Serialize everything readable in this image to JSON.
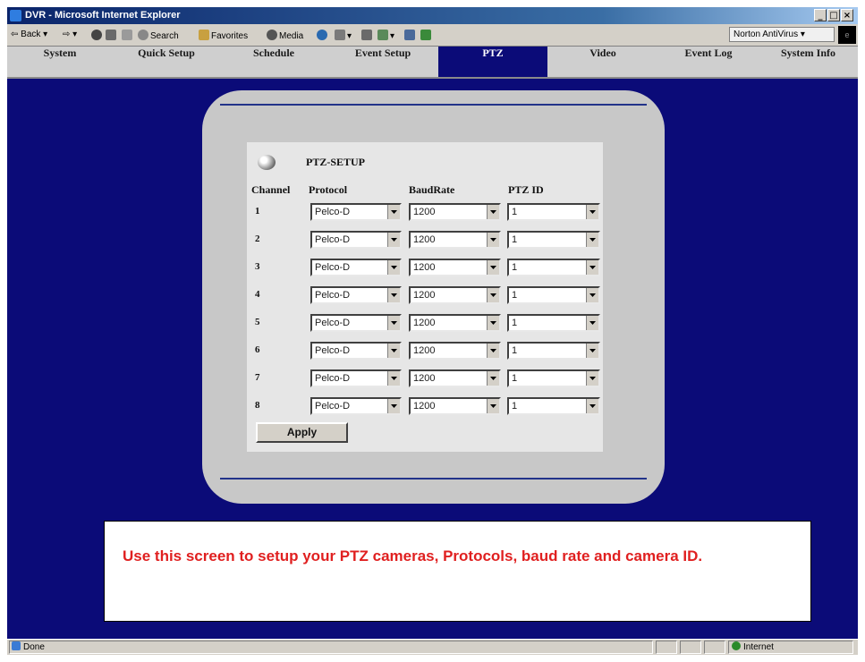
{
  "window": {
    "title": "DVR - Microsoft Internet Explorer"
  },
  "toolbar": {
    "back": "Back",
    "search": "Search",
    "favorites": "Favorites",
    "media": "Media",
    "norton": "Norton AntiVirus"
  },
  "nav": {
    "tabs": [
      "System",
      "Quick Setup",
      "Schedule",
      "Event Setup",
      "PTZ",
      "Video",
      "Event Log",
      "System Info"
    ],
    "active": "PTZ"
  },
  "ptz": {
    "title": "PTZ-SETUP",
    "headers": {
      "channel": "Channel",
      "protocol": "Protocol",
      "baud": "BaudRate",
      "id": "PTZ ID"
    },
    "rows": [
      {
        "channel": "1",
        "protocol": "Pelco-D",
        "baud": "1200",
        "id": "1"
      },
      {
        "channel": "2",
        "protocol": "Pelco-D",
        "baud": "1200",
        "id": "1"
      },
      {
        "channel": "3",
        "protocol": "Pelco-D",
        "baud": "1200",
        "id": "1"
      },
      {
        "channel": "4",
        "protocol": "Pelco-D",
        "baud": "1200",
        "id": "1"
      },
      {
        "channel": "5",
        "protocol": "Pelco-D",
        "baud": "1200",
        "id": "1"
      },
      {
        "channel": "6",
        "protocol": "Pelco-D",
        "baud": "1200",
        "id": "1"
      },
      {
        "channel": "7",
        "protocol": "Pelco-D",
        "baud": "1200",
        "id": "1"
      },
      {
        "channel": "8",
        "protocol": "Pelco-D",
        "baud": "1200",
        "id": "1"
      }
    ],
    "apply_label": "Apply"
  },
  "caption": "Use this screen to setup your PTZ cameras, Protocols, baud rate and camera ID.",
  "status": {
    "left": "Done",
    "zone": "Internet"
  },
  "colors": {
    "content_bg": "#0b0b78",
    "panel": "#c8c8c8",
    "caption_text": "#e02020"
  }
}
